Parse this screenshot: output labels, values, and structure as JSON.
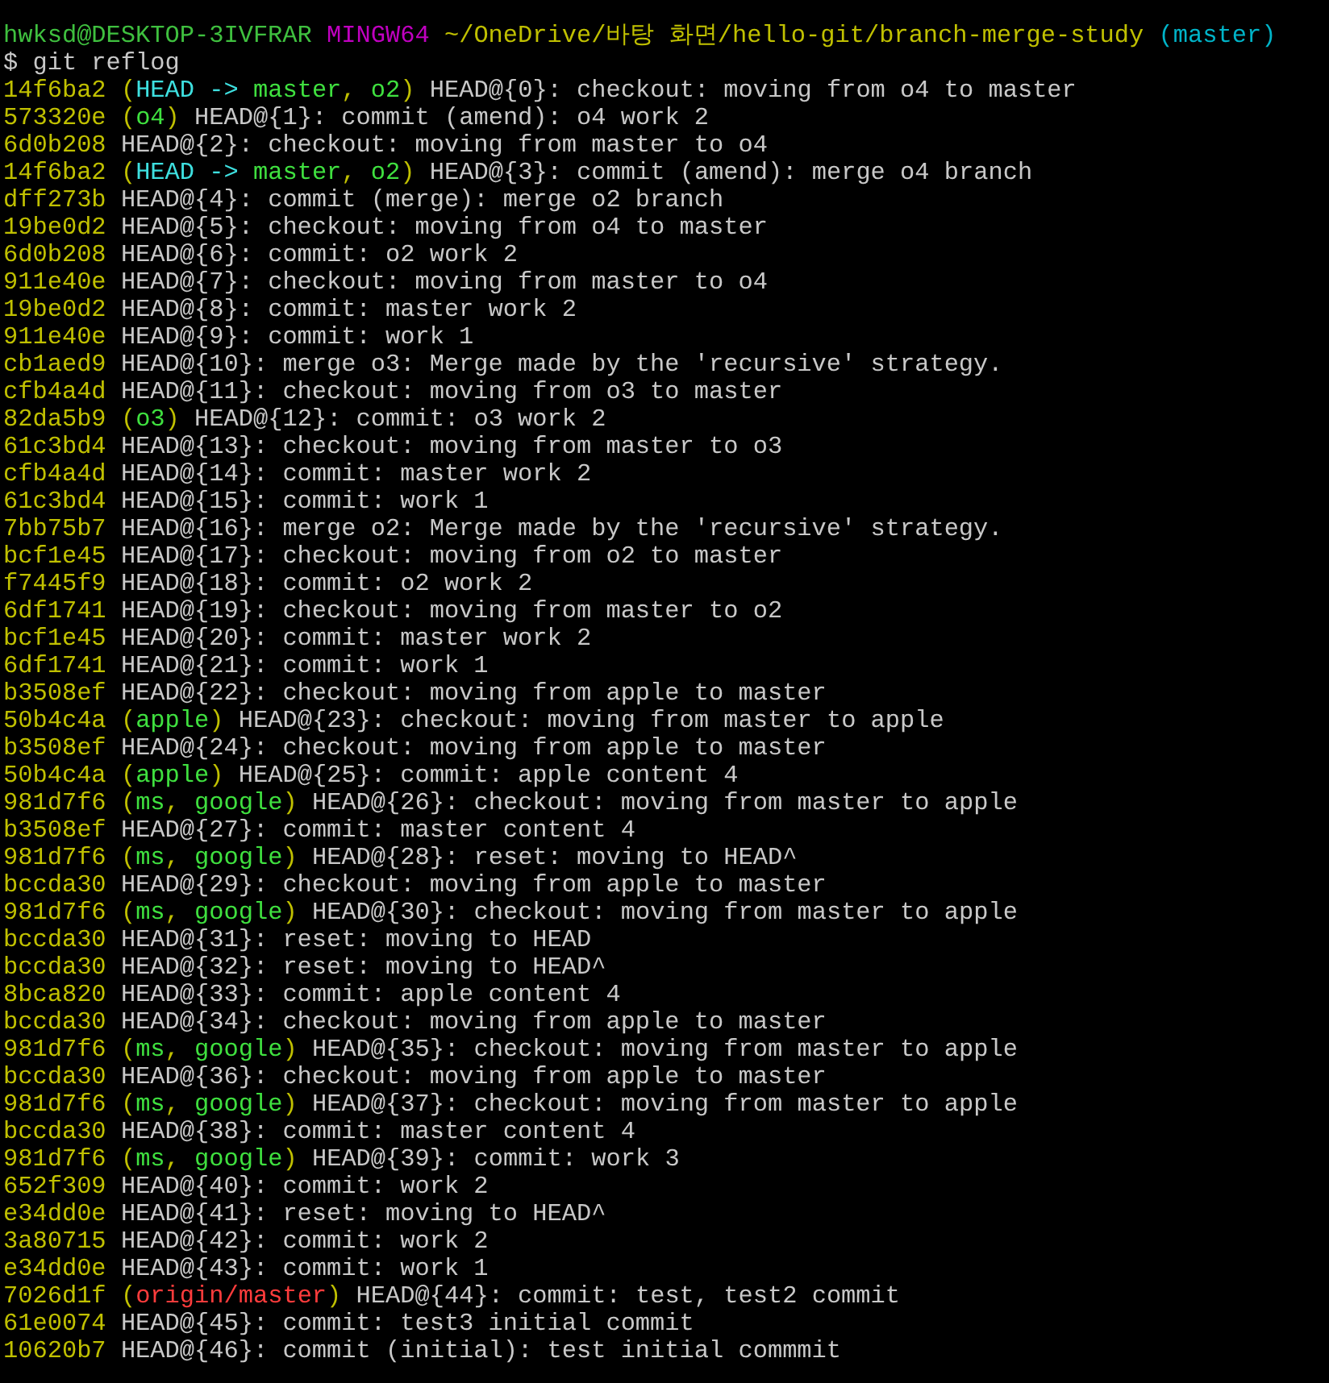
{
  "prompt": {
    "user_host": "hwksd@DESKTOP-3IVFRAR",
    "shell": "MINGW64",
    "path": "~/OneDrive/바탕 화면/hello-git/branch-merge-study",
    "branch": "(master)"
  },
  "command": "$ git reflog",
  "entries": [
    {
      "hash": "14f6ba2",
      "refs": [
        {
          "text": "(",
          "kind": "punct"
        },
        {
          "text": "HEAD -> ",
          "kind": "head"
        },
        {
          "text": "master",
          "kind": "branch"
        },
        {
          "text": ", ",
          "kind": "punct"
        },
        {
          "text": "o2",
          "kind": "branch"
        },
        {
          "text": ")",
          "kind": "punct"
        }
      ],
      "text": "HEAD@{0}: checkout: moving from o4 to master"
    },
    {
      "hash": "573320e",
      "refs": [
        {
          "text": "(",
          "kind": "punct"
        },
        {
          "text": "o4",
          "kind": "branch"
        },
        {
          "text": ")",
          "kind": "punct"
        }
      ],
      "text": "HEAD@{1}: commit (amend): o4 work 2"
    },
    {
      "hash": "6d0b208",
      "text": "HEAD@{2}: checkout: moving from master to o4"
    },
    {
      "hash": "14f6ba2",
      "refs": [
        {
          "text": "(",
          "kind": "punct"
        },
        {
          "text": "HEAD -> ",
          "kind": "head"
        },
        {
          "text": "master",
          "kind": "branch"
        },
        {
          "text": ", ",
          "kind": "punct"
        },
        {
          "text": "o2",
          "kind": "branch"
        },
        {
          "text": ")",
          "kind": "punct"
        }
      ],
      "text": "HEAD@{3}: commit (amend): merge o4 branch"
    },
    {
      "hash": "dff273b",
      "text": "HEAD@{4}: commit (merge): merge o2 branch"
    },
    {
      "hash": "19be0d2",
      "text": "HEAD@{5}: checkout: moving from o4 to master"
    },
    {
      "hash": "6d0b208",
      "text": "HEAD@{6}: commit: o2 work 2"
    },
    {
      "hash": "911e40e",
      "text": "HEAD@{7}: checkout: moving from master to o4"
    },
    {
      "hash": "19be0d2",
      "text": "HEAD@{8}: commit: master work 2"
    },
    {
      "hash": "911e40e",
      "text": "HEAD@{9}: commit: work 1"
    },
    {
      "hash": "cb1aed9",
      "text": "HEAD@{10}: merge o3: Merge made by the 'recursive' strategy."
    },
    {
      "hash": "cfb4a4d",
      "text": "HEAD@{11}: checkout: moving from o3 to master"
    },
    {
      "hash": "82da5b9",
      "refs": [
        {
          "text": "(",
          "kind": "punct"
        },
        {
          "text": "o3",
          "kind": "branch"
        },
        {
          "text": ")",
          "kind": "punct"
        }
      ],
      "text": "HEAD@{12}: commit: o3 work 2"
    },
    {
      "hash": "61c3bd4",
      "text": "HEAD@{13}: checkout: moving from master to o3"
    },
    {
      "hash": "cfb4a4d",
      "text": "HEAD@{14}: commit: master work 2"
    },
    {
      "hash": "61c3bd4",
      "text": "HEAD@{15}: commit: work 1"
    },
    {
      "hash": "7bb75b7",
      "text": "HEAD@{16}: merge o2: Merge made by the 'recursive' strategy."
    },
    {
      "hash": "bcf1e45",
      "text": "HEAD@{17}: checkout: moving from o2 to master"
    },
    {
      "hash": "f7445f9",
      "text": "HEAD@{18}: commit: o2 work 2"
    },
    {
      "hash": "6df1741",
      "text": "HEAD@{19}: checkout: moving from master to o2"
    },
    {
      "hash": "bcf1e45",
      "text": "HEAD@{20}: commit: master work 2"
    },
    {
      "hash": "6df1741",
      "text": "HEAD@{21}: commit: work 1"
    },
    {
      "hash": "b3508ef",
      "text": "HEAD@{22}: checkout: moving from apple to master"
    },
    {
      "hash": "50b4c4a",
      "refs": [
        {
          "text": "(",
          "kind": "punct"
        },
        {
          "text": "apple",
          "kind": "branch"
        },
        {
          "text": ")",
          "kind": "punct"
        }
      ],
      "text": "HEAD@{23}: checkout: moving from master to apple"
    },
    {
      "hash": "b3508ef",
      "text": "HEAD@{24}: checkout: moving from apple to master"
    },
    {
      "hash": "50b4c4a",
      "refs": [
        {
          "text": "(",
          "kind": "punct"
        },
        {
          "text": "apple",
          "kind": "branch"
        },
        {
          "text": ")",
          "kind": "punct"
        }
      ],
      "text": "HEAD@{25}: commit: apple content 4"
    },
    {
      "hash": "981d7f6",
      "refs": [
        {
          "text": "(",
          "kind": "punct"
        },
        {
          "text": "ms",
          "kind": "branch"
        },
        {
          "text": ", ",
          "kind": "punct"
        },
        {
          "text": "google",
          "kind": "branch"
        },
        {
          "text": ")",
          "kind": "punct"
        }
      ],
      "text": "HEAD@{26}: checkout: moving from master to apple"
    },
    {
      "hash": "b3508ef",
      "text": "HEAD@{27}: commit: master content 4"
    },
    {
      "hash": "981d7f6",
      "refs": [
        {
          "text": "(",
          "kind": "punct"
        },
        {
          "text": "ms",
          "kind": "branch"
        },
        {
          "text": ", ",
          "kind": "punct"
        },
        {
          "text": "google",
          "kind": "branch"
        },
        {
          "text": ")",
          "kind": "punct"
        }
      ],
      "text": "HEAD@{28}: reset: moving to HEAD^"
    },
    {
      "hash": "bccda30",
      "text": "HEAD@{29}: checkout: moving from apple to master"
    },
    {
      "hash": "981d7f6",
      "refs": [
        {
          "text": "(",
          "kind": "punct"
        },
        {
          "text": "ms",
          "kind": "branch"
        },
        {
          "text": ", ",
          "kind": "punct"
        },
        {
          "text": "google",
          "kind": "branch"
        },
        {
          "text": ")",
          "kind": "punct"
        }
      ],
      "text": "HEAD@{30}: checkout: moving from master to apple"
    },
    {
      "hash": "bccda30",
      "text": "HEAD@{31}: reset: moving to HEAD"
    },
    {
      "hash": "bccda30",
      "text": "HEAD@{32}: reset: moving to HEAD^"
    },
    {
      "hash": "8bca820",
      "text": "HEAD@{33}: commit: apple content 4"
    },
    {
      "hash": "bccda30",
      "text": "HEAD@{34}: checkout: moving from apple to master"
    },
    {
      "hash": "981d7f6",
      "refs": [
        {
          "text": "(",
          "kind": "punct"
        },
        {
          "text": "ms",
          "kind": "branch"
        },
        {
          "text": ", ",
          "kind": "punct"
        },
        {
          "text": "google",
          "kind": "branch"
        },
        {
          "text": ")",
          "kind": "punct"
        }
      ],
      "text": "HEAD@{35}: checkout: moving from master to apple"
    },
    {
      "hash": "bccda30",
      "text": "HEAD@{36}: checkout: moving from apple to master"
    },
    {
      "hash": "981d7f6",
      "refs": [
        {
          "text": "(",
          "kind": "punct"
        },
        {
          "text": "ms",
          "kind": "branch"
        },
        {
          "text": ", ",
          "kind": "punct"
        },
        {
          "text": "google",
          "kind": "branch"
        },
        {
          "text": ")",
          "kind": "punct"
        }
      ],
      "text": "HEAD@{37}: checkout: moving from master to apple"
    },
    {
      "hash": "bccda30",
      "text": "HEAD@{38}: commit: master content 4"
    },
    {
      "hash": "981d7f6",
      "refs": [
        {
          "text": "(",
          "kind": "punct"
        },
        {
          "text": "ms",
          "kind": "branch"
        },
        {
          "text": ", ",
          "kind": "punct"
        },
        {
          "text": "google",
          "kind": "branch"
        },
        {
          "text": ")",
          "kind": "punct"
        }
      ],
      "text": "HEAD@{39}: commit: work 3"
    },
    {
      "hash": "652f309",
      "text": "HEAD@{40}: commit: work 2"
    },
    {
      "hash": "e34dd0e",
      "text": "HEAD@{41}: reset: moving to HEAD^"
    },
    {
      "hash": "3a80715",
      "text": "HEAD@{42}: commit: work 2"
    },
    {
      "hash": "e34dd0e",
      "text": "HEAD@{43}: commit: work 1"
    },
    {
      "hash": "7026d1f",
      "refs": [
        {
          "text": "(",
          "kind": "punct"
        },
        {
          "text": "origin/master",
          "kind": "remote"
        },
        {
          "text": ")",
          "kind": "punct"
        }
      ],
      "text": "HEAD@{44}: commit: test, test2 commit"
    },
    {
      "hash": "61e0074",
      "text": "HEAD@{45}: commit: test3 initial commit"
    },
    {
      "hash": "10620b7",
      "text": "HEAD@{46}: commit (initial): test initial commmit"
    }
  ]
}
